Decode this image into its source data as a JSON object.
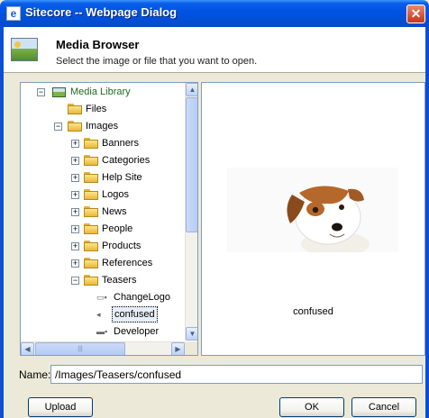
{
  "window": {
    "title": "Sitecore -- Webpage Dialog",
    "close_glyph": "✕",
    "icon": "ie-icon"
  },
  "header": {
    "title": "Media Browser",
    "subtitle": "Select the image or file that you want to open.",
    "icon": "media-browser-icon"
  },
  "tree": {
    "root": {
      "label": "Media Library",
      "expander": "⊟",
      "icon": "media-library-icon"
    },
    "files": {
      "label": "Files"
    },
    "images": {
      "label": "Images",
      "expander": "⊟"
    },
    "image_children": [
      {
        "label": "Banners",
        "expander": "+"
      },
      {
        "label": "Categories",
        "expander": "+"
      },
      {
        "label": "Help Site",
        "expander": "+"
      },
      {
        "label": "Logos",
        "expander": "+"
      },
      {
        "label": "News",
        "expander": "+"
      },
      {
        "label": "People",
        "expander": "+"
      },
      {
        "label": "Products",
        "expander": "+"
      },
      {
        "label": "References",
        "expander": "+"
      },
      {
        "label": "Teasers",
        "expander": "−"
      }
    ],
    "teasers_children": [
      {
        "label": "ChangeLogo"
      },
      {
        "label": "confused",
        "selected": true
      },
      {
        "label": "Developer"
      }
    ],
    "scroll_up": "▲",
    "scroll_down": "▼",
    "scroll_left": "◀",
    "scroll_right": "▶",
    "thumb_grip": "|||"
  },
  "preview": {
    "caption": "confused"
  },
  "name_field": {
    "label": "Name:",
    "value": "/Images/Teasers/confused"
  },
  "buttons": {
    "upload": "Upload",
    "ok": "OK",
    "cancel": "Cancel"
  }
}
